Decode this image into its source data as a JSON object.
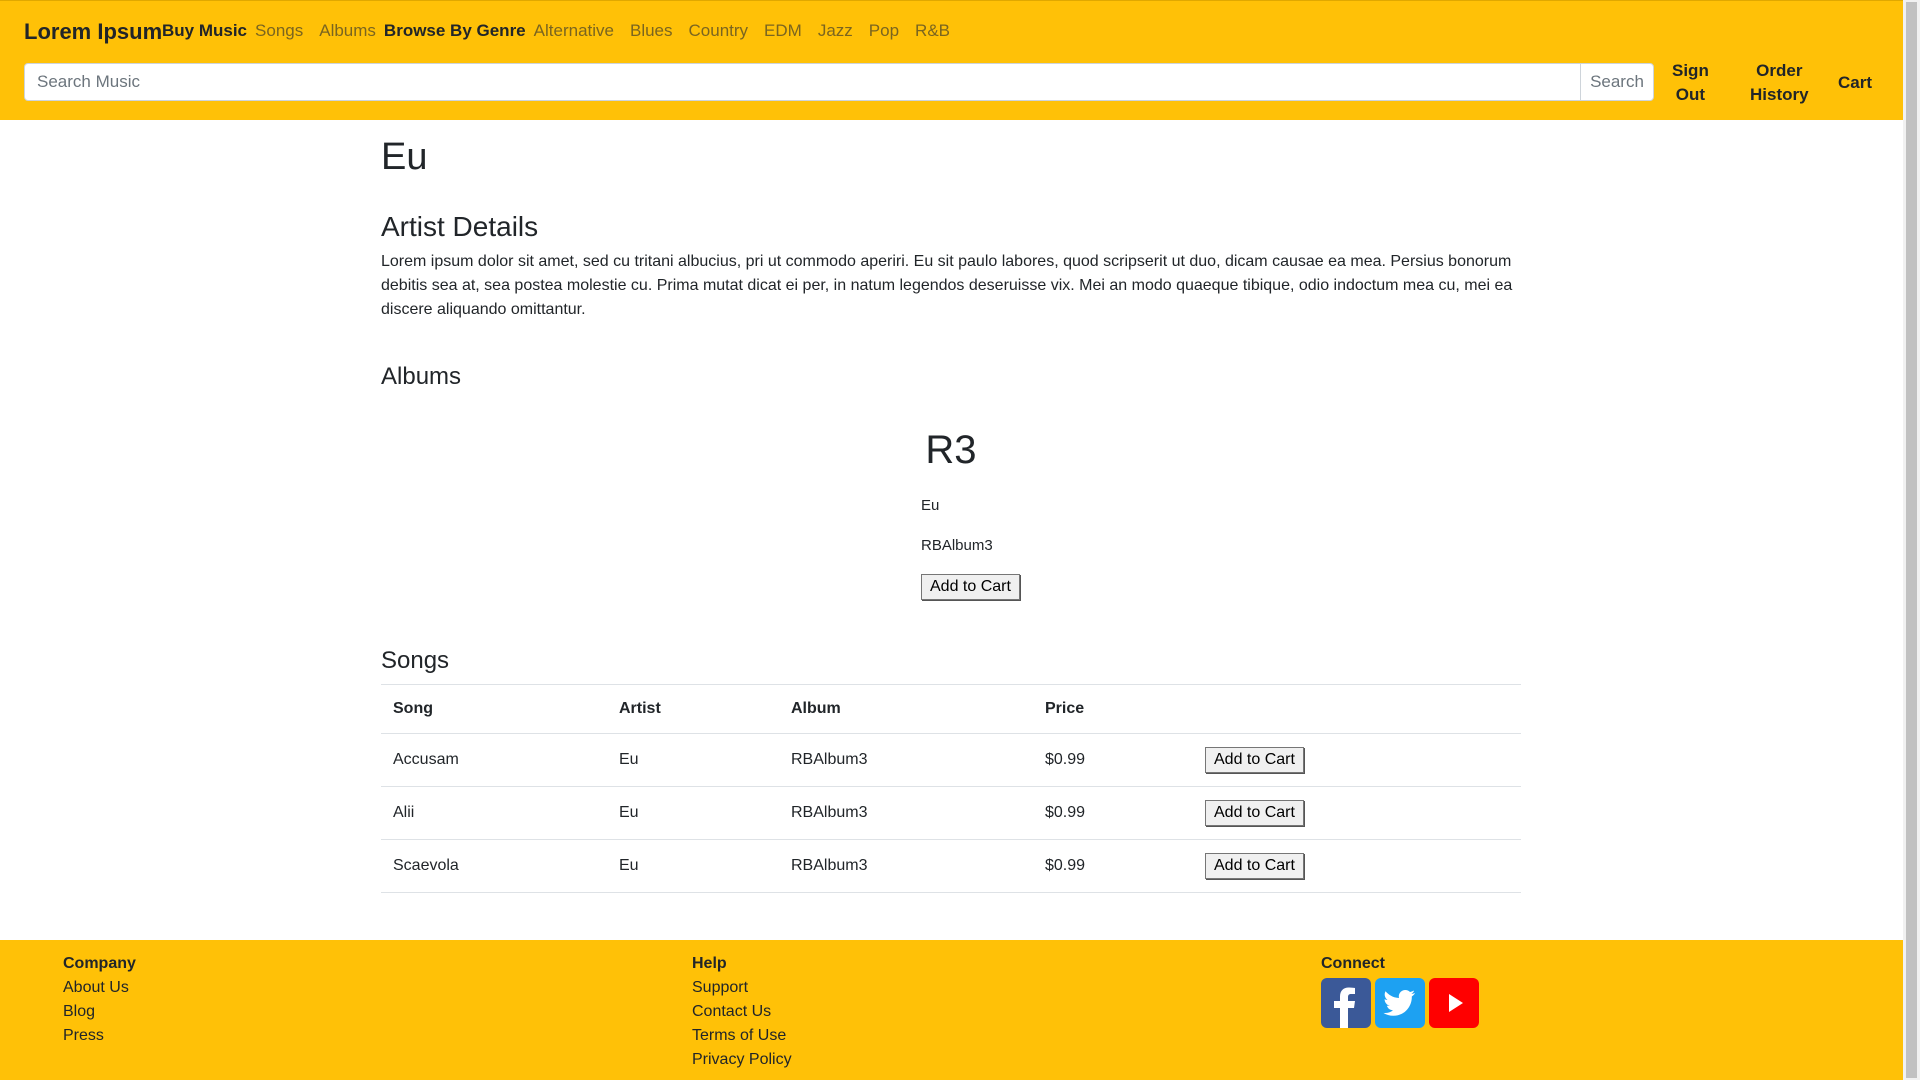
{
  "header": {
    "brand": "Lorem Ipsum",
    "nav_buy_music": "Buy Music",
    "nav_songs": "Songs",
    "nav_albums": "Albums",
    "nav_browse_by_genre": "Browse By Genre",
    "genres": [
      "Alternative",
      "Blues",
      "Country",
      "EDM",
      "Jazz",
      "Pop",
      "R&B"
    ],
    "search_placeholder": "Search Music",
    "search_button": "Search",
    "sign_out_line1": "Sign",
    "sign_out_line2": "Out",
    "order_history_line1": "Order",
    "order_history_line2": "History",
    "cart": "Cart"
  },
  "artist": {
    "name": "Eu",
    "details_heading": "Artist Details",
    "details_text": "Lorem ipsum dolor sit amet, sed cu tritani albucius, pri ut commodo aperiri. Eu sit paulo labores, quod scripserit ut duo, dicam causae ea mea. Persius bonorum debitis sea at, sea postea molestie cu. Prima mutat dicat ei per, in natum legendos deseruisse vix. Mei an modo quaeque tibique, odio indoctum mea cu, mei ea discere aliquando omittantur."
  },
  "albums": {
    "heading": "Albums",
    "items": [
      {
        "title": "R3",
        "artist": "Eu",
        "album": "RBAlbum3",
        "button": "Add to Cart"
      }
    ]
  },
  "songs": {
    "heading": "Songs",
    "columns": [
      "Song",
      "Artist",
      "Album",
      "Price"
    ],
    "rows": [
      {
        "song": "Accusam",
        "artist": "Eu",
        "album": "RBAlbum3",
        "price": "$0.99",
        "button": "Add to Cart"
      },
      {
        "song": "Alii",
        "artist": "Eu",
        "album": "RBAlbum3",
        "price": "$0.99",
        "button": "Add to Cart"
      },
      {
        "song": "Scaevola",
        "artist": "Eu",
        "album": "RBAlbum3",
        "price": "$0.99",
        "button": "Add to Cart"
      }
    ]
  },
  "footer": {
    "company_heading": "Company",
    "company_links": [
      "About Us",
      "Blog",
      "Press"
    ],
    "help_heading": "Help",
    "help_links": [
      "Support",
      "Contact Us",
      "Terms of Use",
      "Privacy Policy"
    ],
    "connect_heading": "Connect",
    "social": [
      {
        "icon": "facebook-icon",
        "color": "#3b5998"
      },
      {
        "icon": "twitter-icon",
        "color": "#1da1f2"
      },
      {
        "icon": "youtube-icon",
        "color": "#ff0000"
      }
    ]
  },
  "colors": {
    "accent": "#ffc107",
    "text": "#212529"
  }
}
